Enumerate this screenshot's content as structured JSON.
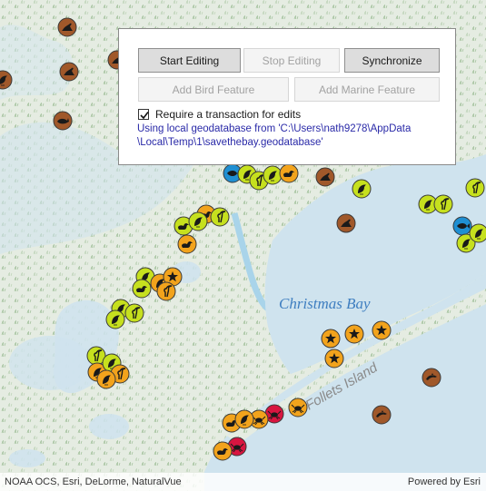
{
  "panel": {
    "buttons": {
      "start_editing": "Start Editing",
      "stop_editing": "Stop Editing",
      "synchronize": "Synchronize",
      "add_bird": "Add Bird Feature",
      "add_marine": "Add Marine Feature"
    },
    "transaction_checkbox": {
      "label": "Require a transaction for edits",
      "checked": true
    },
    "status_lines": [
      "Using local geodatabase from 'C:\\Users\\nath9278\\AppData",
      "\\Local\\Temp\\1\\savethebay.geodatabase'"
    ]
  },
  "map": {
    "labels": {
      "bay": "Christmas Bay",
      "island": "Follets Island"
    },
    "feature_colors": {
      "bird": "#c6e01e",
      "marine_seal": "#a0582a",
      "bird_orange": "#f2a31c",
      "fish_blue": "#1f8fd2",
      "crab_red": "#d81540"
    },
    "feature_icons": [
      "seal-icon",
      "whale-icon",
      "bird-icon",
      "duck-icon",
      "heron-icon",
      "starfish-icon",
      "crab-icon",
      "fish-icon",
      "dolphin-icon"
    ]
  },
  "attribution": {
    "left": "NOAA OCS, Esri, DeLorme, NaturalVue",
    "right": "Powered by Esri"
  }
}
